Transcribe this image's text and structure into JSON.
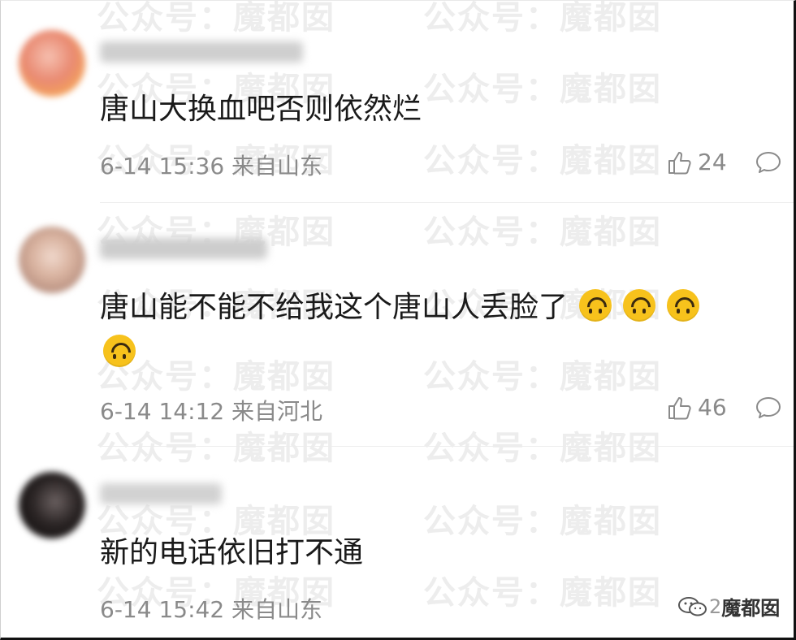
{
  "watermark": "公众号：魔都囡",
  "comments": [
    {
      "text": "唐山大换血吧否则依然烂",
      "date": "6-14 15:36",
      "location": "来自山东",
      "likes": "24"
    },
    {
      "text": "唐山能不能不给我这个唐山人丢脸了",
      "emoji_count": 4,
      "date": "6-14 14:12",
      "location": "来自河北",
      "likes": "46"
    },
    {
      "text": "新的电话依旧打不通",
      "date": "6-14 15:42",
      "location": "来自山东"
    }
  ],
  "footer": {
    "brand": "魔都囡",
    "prefix": "2"
  },
  "colors": {
    "meta": "#8a8a8a",
    "text": "#1a1a1a",
    "emoji": "#f7c21c"
  }
}
